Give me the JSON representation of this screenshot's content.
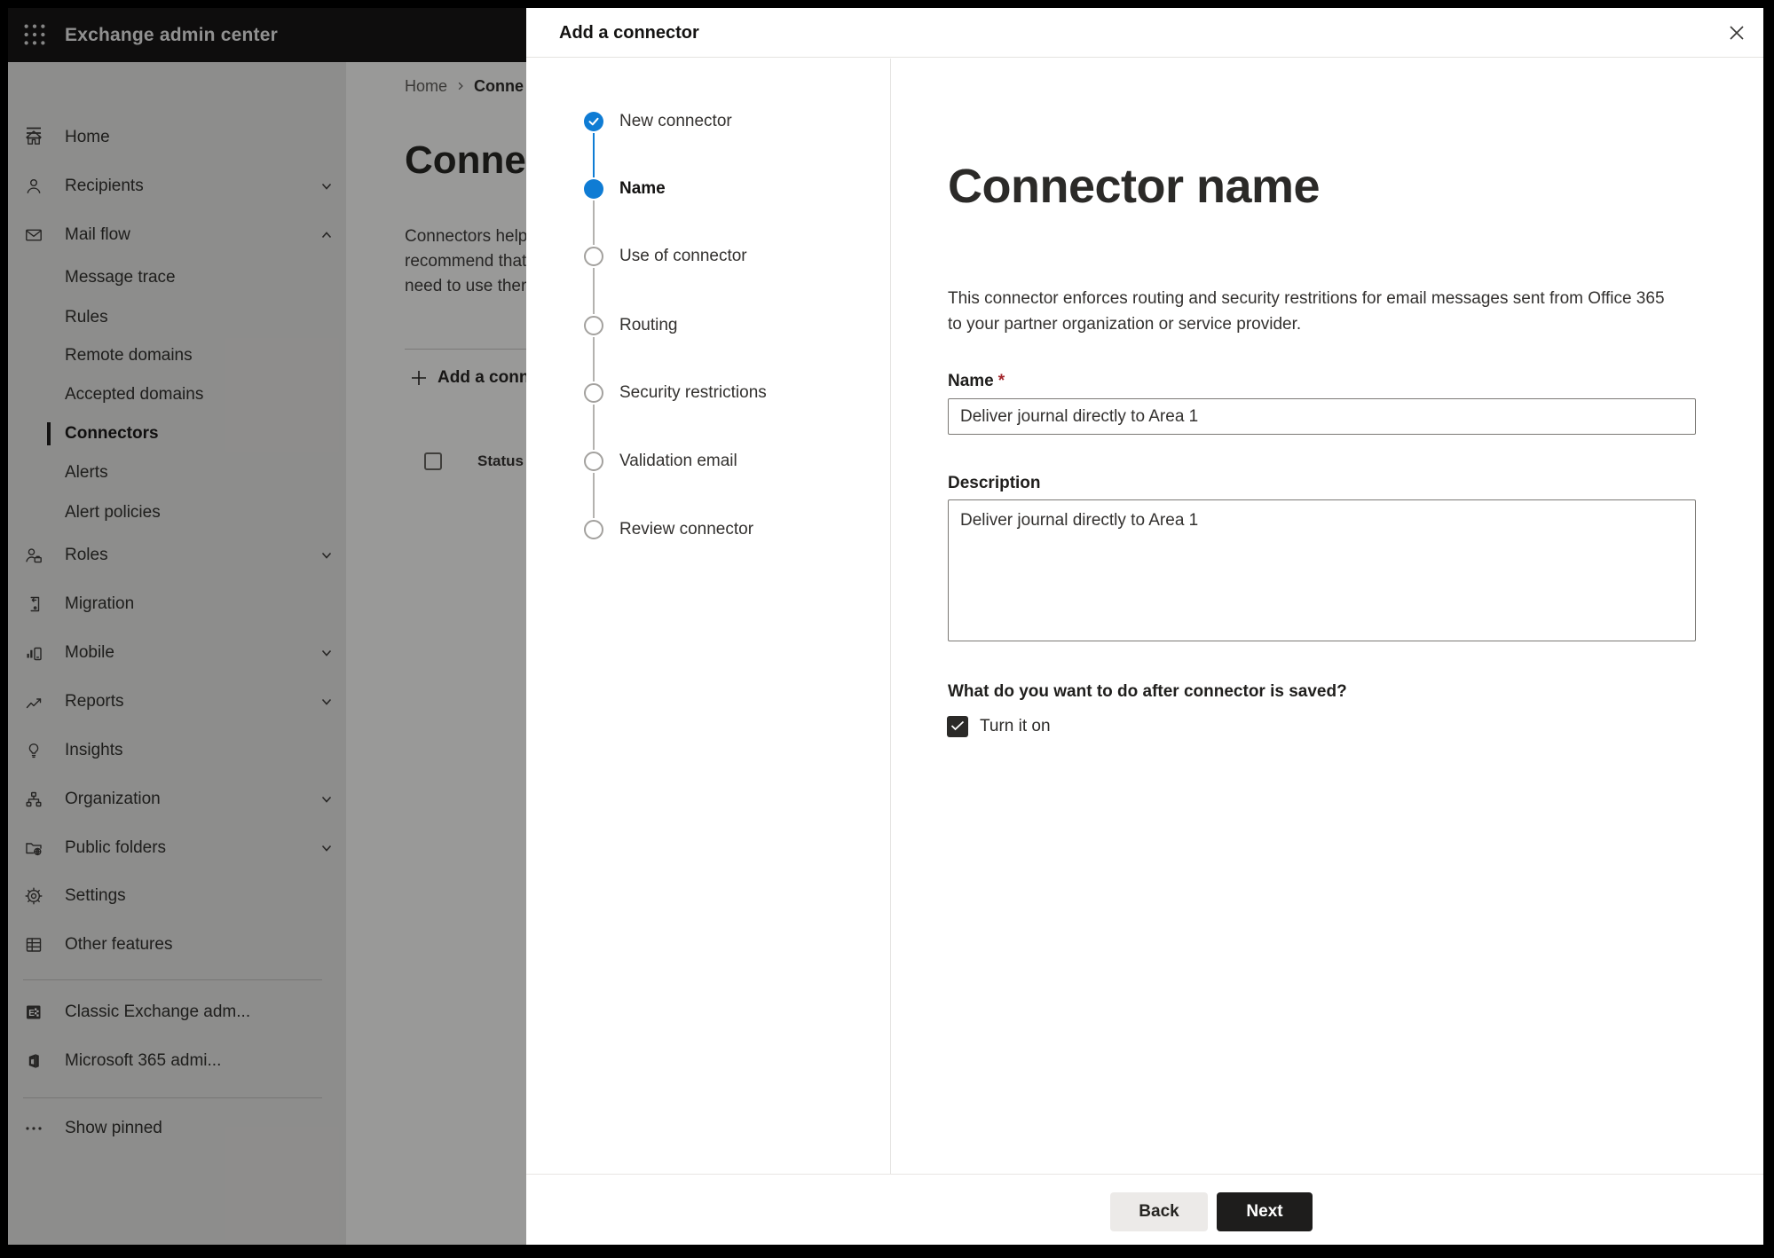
{
  "app": {
    "title": "Exchange admin center"
  },
  "sidebar": {
    "items": [
      {
        "label": "Home",
        "icon": "home"
      },
      {
        "label": "Recipients",
        "icon": "person",
        "chevron": "down"
      },
      {
        "label": "Mail flow",
        "icon": "mail",
        "chevron": "up"
      },
      {
        "label": "Message trace",
        "sub": true
      },
      {
        "label": "Rules",
        "sub": true
      },
      {
        "label": "Remote domains",
        "sub": true
      },
      {
        "label": "Accepted domains",
        "sub": true
      },
      {
        "label": "Connectors",
        "sub": true,
        "selected": true
      },
      {
        "label": "Alerts",
        "sub": true
      },
      {
        "label": "Alert policies",
        "sub": true
      },
      {
        "label": "Roles",
        "icon": "roles",
        "chevron": "down"
      },
      {
        "label": "Migration",
        "icon": "migration"
      },
      {
        "label": "Mobile",
        "icon": "mobile",
        "chevron": "down"
      },
      {
        "label": "Reports",
        "icon": "reports",
        "chevron": "down"
      },
      {
        "label": "Insights",
        "icon": "insights"
      },
      {
        "label": "Organization",
        "icon": "organization",
        "chevron": "down"
      },
      {
        "label": "Public folders",
        "icon": "folders",
        "chevron": "down"
      },
      {
        "label": "Settings",
        "icon": "settings"
      },
      {
        "label": "Other features",
        "icon": "grid"
      },
      {
        "label": "Classic Exchange adm...",
        "icon": "exchange"
      },
      {
        "label": "Microsoft 365 admi...",
        "icon": "m365"
      },
      {
        "label": "Show pinned",
        "icon": "ellipsis"
      }
    ]
  },
  "page": {
    "breadcrumb": {
      "home": "Home",
      "current": "Conne"
    },
    "title": "Connec",
    "description_lines": [
      "Connectors help",
      "recommend that",
      "need to use ther"
    ],
    "add_button": "Add a conn",
    "status_header": "Status"
  },
  "dialog": {
    "title": "Add a connector",
    "steps": [
      {
        "label": "New connector",
        "state": "completed"
      },
      {
        "label": "Name",
        "state": "current"
      },
      {
        "label": "Use of connector",
        "state": "upcoming"
      },
      {
        "label": "Routing",
        "state": "upcoming"
      },
      {
        "label": "Security restrictions",
        "state": "upcoming"
      },
      {
        "label": "Validation email",
        "state": "upcoming"
      },
      {
        "label": "Review connector",
        "state": "upcoming"
      }
    ],
    "content": {
      "heading": "Connector name",
      "intro_lines": [
        "This connector enforces routing and security restritions for email messages sent from Office 365",
        "to your partner organization or service provider."
      ],
      "name_label": "Name",
      "required_mark": "*",
      "name_value": "Deliver journal directly to Area 1",
      "description_label": "Description",
      "description_value": "Deliver journal directly to Area 1",
      "after_save_question": "What do you want to do after connector is saved?",
      "turn_on_label": "Turn it on",
      "turn_on_checked": true
    },
    "footer": {
      "back": "Back",
      "next": "Next"
    }
  },
  "colors": {
    "accent": "#0f7cd4",
    "required_mark": "#a4262c",
    "next_button_bg": "#1e1d1c",
    "back_button_bg": "#eceae8"
  }
}
